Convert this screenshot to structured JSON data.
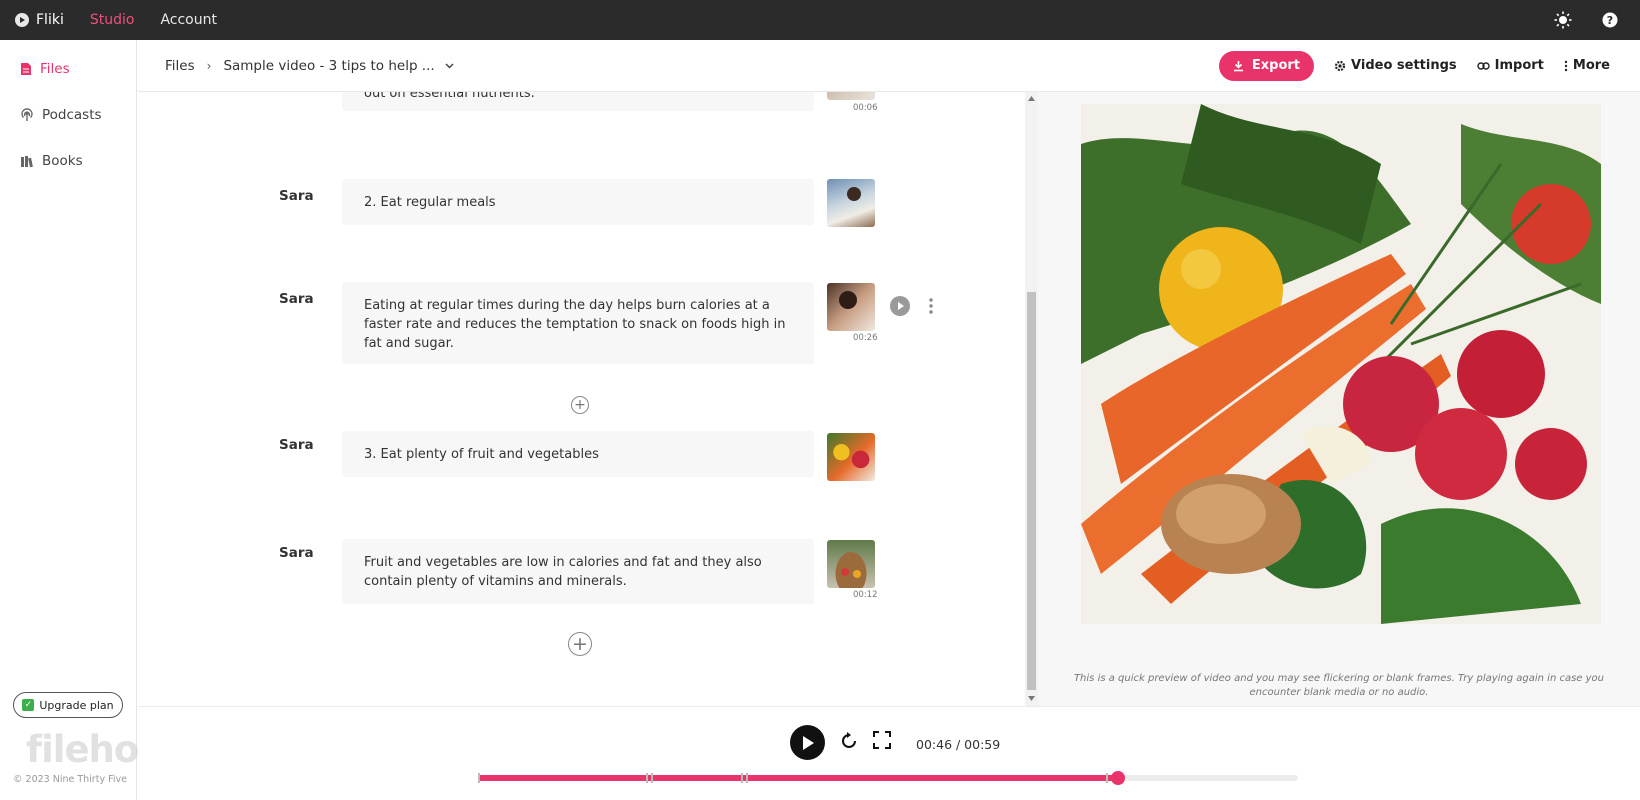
{
  "topbar": {
    "brand": "Fliki",
    "nav": [
      "Studio",
      "Account"
    ],
    "active_nav": "Studio"
  },
  "sidebar": {
    "items": [
      {
        "label": "Files",
        "icon": "document-icon",
        "active": true
      },
      {
        "label": "Podcasts",
        "icon": "podcast-icon",
        "active": false
      },
      {
        "label": "Books",
        "icon": "book-icon",
        "active": false
      }
    ],
    "upgrade_label": "Upgrade plan",
    "copyright": "© 2023 Nine Thirty Five",
    "watermark": "filehorse.com"
  },
  "header": {
    "breadcrumb_root": "Files",
    "breadcrumb_current": "Sample video - 3 tips to help ...",
    "export_label": "Export",
    "video_settings_label": "Video settings",
    "import_label": "Import",
    "more_label": "More"
  },
  "scenes": [
    {
      "speaker": "",
      "text": "out on essential nutrients.",
      "duration": "00:06"
    },
    {
      "speaker": "Sara",
      "text": "2. Eat regular meals",
      "duration": ""
    },
    {
      "speaker": "Sara",
      "text": "Eating at regular times during the day helps burn calories at a faster rate and reduces the temptation to snack on foods high in fat and sugar.",
      "duration": "00:26"
    },
    {
      "speaker": "Sara",
      "text": "3. Eat plenty of fruit and vegetables",
      "duration": ""
    },
    {
      "speaker": "Sara",
      "text": "Fruit and vegetables are low in calories and fat and they also contain plenty of vitamins and minerals.",
      "duration": "00:12"
    }
  ],
  "preview": {
    "note": "This is a quick preview of video and you may see flickering or blank frames. Try playing again in case you encounter blank media or no audio."
  },
  "player": {
    "time": "00:46 / 00:59",
    "progress": 0.78
  },
  "colors": {
    "accent": "#e8336b",
    "topbar": "#2b2b2b"
  }
}
